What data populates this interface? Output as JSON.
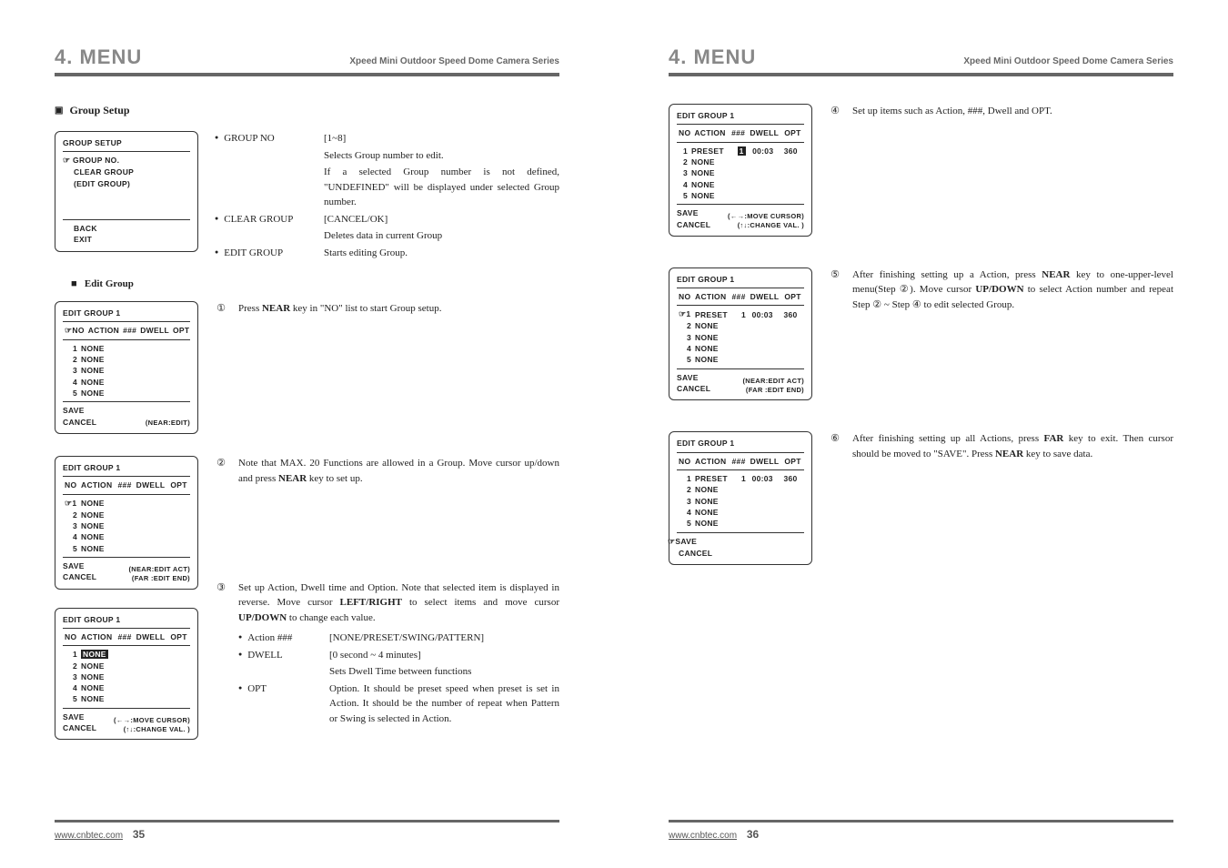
{
  "header": {
    "menu": "4. MENU",
    "series": "Xpeed Mini Outdoor Speed Dome Camera Series"
  },
  "footer": {
    "url": "www.cnbtec.com",
    "page_left": "35",
    "page_right": "36"
  },
  "left_page": {
    "section_title": "Group Setup",
    "osd_group_setup": {
      "title": "GROUP SETUP",
      "items": [
        "GROUP NO.",
        "CLEAR GROUP",
        "(EDIT GROUP)"
      ],
      "back": "BACK",
      "exit": "EXIT"
    },
    "group_defs": {
      "group_no_k": "GROUP NO",
      "group_no_range": "[1~8]",
      "group_no_desc1": "Selects Group number to edit.",
      "group_no_desc2": "If a selected Group number is not defined, \"UNDEFINED\" will be displayed under selected Group number.",
      "clear_group_k": "CLEAR GROUP",
      "clear_group_range": "[CANCEL/OK]",
      "clear_group_desc": "Deletes data in current Group",
      "edit_group_k": "EDIT GROUP",
      "edit_group_desc": "Starts editing Group."
    },
    "subsection": "Edit Group",
    "osd1": {
      "title": "EDIT GROUP 1",
      "cols": [
        "NO",
        "ACTION",
        "###",
        "DWELL",
        "OPT"
      ],
      "rows": [
        [
          "1",
          "NONE",
          "",
          "",
          ""
        ],
        [
          "2",
          "NONE",
          "",
          "",
          ""
        ],
        [
          "3",
          "NONE",
          "",
          "",
          ""
        ],
        [
          "4",
          "NONE",
          "",
          "",
          ""
        ],
        [
          "5",
          "NONE",
          "",
          "",
          ""
        ]
      ],
      "save": "SAVE",
      "cancel": "CANCEL",
      "note": "(NEAR:EDIT)",
      "cursor": "header"
    },
    "step1": "Press NEAR key in \"NO\" list to start Group setup.",
    "osd2": {
      "title": "EDIT GROUP 1",
      "cols": [
        "NO",
        "ACTION",
        "###",
        "DWELL",
        "OPT"
      ],
      "rows": [
        [
          "1",
          "NONE",
          "",
          "",
          ""
        ],
        [
          "2",
          "NONE",
          "",
          "",
          ""
        ],
        [
          "3",
          "NONE",
          "",
          "",
          ""
        ],
        [
          "4",
          "NONE",
          "",
          "",
          ""
        ],
        [
          "5",
          "NONE",
          "",
          "",
          ""
        ]
      ],
      "save": "SAVE",
      "cancel": "CANCEL",
      "note1": "(NEAR:EDIT ACT)",
      "note2": "(FAR :EDIT END)",
      "cursor": "row1"
    },
    "step2": "Note that MAX. 20 Functions are allowed in a Group. Move cursor up/down and press NEAR key to set up.",
    "osd3": {
      "title": "EDIT GROUP 1",
      "cols": [
        "NO",
        "ACTION",
        "###",
        "DWELL",
        "OPT"
      ],
      "rows": [
        [
          "1",
          "NONE",
          "",
          "",
          ""
        ],
        [
          "2",
          "NONE",
          "",
          "",
          ""
        ],
        [
          "3",
          "NONE",
          "",
          "",
          ""
        ],
        [
          "4",
          "NONE",
          "",
          "",
          ""
        ],
        [
          "5",
          "NONE",
          "",
          "",
          ""
        ]
      ],
      "save": "SAVE",
      "cancel": "CANCEL",
      "note1": "(←→:MOVE CURSOR)",
      "note2": "(↑↓:CHANGE VAL. )"
    },
    "step3_intro": "Set up Action, Dwell time and Option. Note that selected item is displayed in reverse. Move cursor LEFT/RIGHT to select items and move cursor UP/DOWN to change each value.",
    "step3_defs": {
      "action_k": "Action ###",
      "action_v": "[NONE/PRESET/SWING/PATTERN]",
      "dwell_k": "DWELL",
      "dwell_v1": "[0 second ~ 4 minutes]",
      "dwell_v2": "Sets Dwell Time between functions",
      "opt_k": "OPT",
      "opt_v": "Option. It should be preset speed when preset is set in Action. It should be the number of repeat when Pattern or Swing is selected in Action."
    }
  },
  "right_page": {
    "osd4": {
      "title": "EDIT GROUP 1",
      "cols": [
        "NO",
        "ACTION",
        "###",
        "DWELL",
        "OPT"
      ],
      "rows": [
        [
          "1",
          "PRESET",
          "1",
          "00:03",
          "360"
        ],
        [
          "2",
          "NONE",
          "",
          "",
          ""
        ],
        [
          "3",
          "NONE",
          "",
          "",
          ""
        ],
        [
          "4",
          "NONE",
          "",
          "",
          ""
        ],
        [
          "5",
          "NONE",
          "",
          "",
          ""
        ]
      ],
      "save": "SAVE",
      "cancel": "CANCEL",
      "note1": "(←→:MOVE CURSOR)",
      "note2": "(↑↓:CHANGE VAL. )",
      "rev_col": "###"
    },
    "step4": "Set up items such as Action, ###, Dwell and OPT.",
    "osd5": {
      "title": "EDIT GROUP 1",
      "cols": [
        "NO",
        "ACTION",
        "###",
        "DWELL",
        "OPT"
      ],
      "rows": [
        [
          "1",
          "PRESET",
          "1",
          "00:03",
          "360"
        ],
        [
          "2",
          "NONE",
          "",
          "",
          ""
        ],
        [
          "3",
          "NONE",
          "",
          "",
          ""
        ],
        [
          "4",
          "NONE",
          "",
          "",
          ""
        ],
        [
          "5",
          "NONE",
          "",
          "",
          ""
        ]
      ],
      "save": "SAVE",
      "cancel": "CANCEL",
      "note1": "(NEAR:EDIT ACT)",
      "note2": "(FAR :EDIT END)",
      "cursor": "row1"
    },
    "step5": "After finishing setting up a Action, press NEAR key to one-upper-level menu(Step ②). Move cursor UP/DOWN to select Action number and repeat Step ② ~ Step ④ to edit selected Group.",
    "osd6": {
      "title": "EDIT GROUP 1",
      "cols": [
        "NO",
        "ACTION",
        "###",
        "DWELL",
        "OPT"
      ],
      "rows": [
        [
          "1",
          "PRESET",
          "1",
          "00:03",
          "360"
        ],
        [
          "2",
          "NONE",
          "",
          "",
          ""
        ],
        [
          "3",
          "NONE",
          "",
          "",
          ""
        ],
        [
          "4",
          "NONE",
          "",
          "",
          ""
        ],
        [
          "5",
          "NONE",
          "",
          "",
          ""
        ]
      ],
      "save": "SAVE",
      "cancel": "CANCEL",
      "cursor": "save"
    },
    "step6": "After finishing setting up all Actions, press FAR key to exit. Then cursor should be moved to \"SAVE\". Press NEAR key to save data."
  }
}
